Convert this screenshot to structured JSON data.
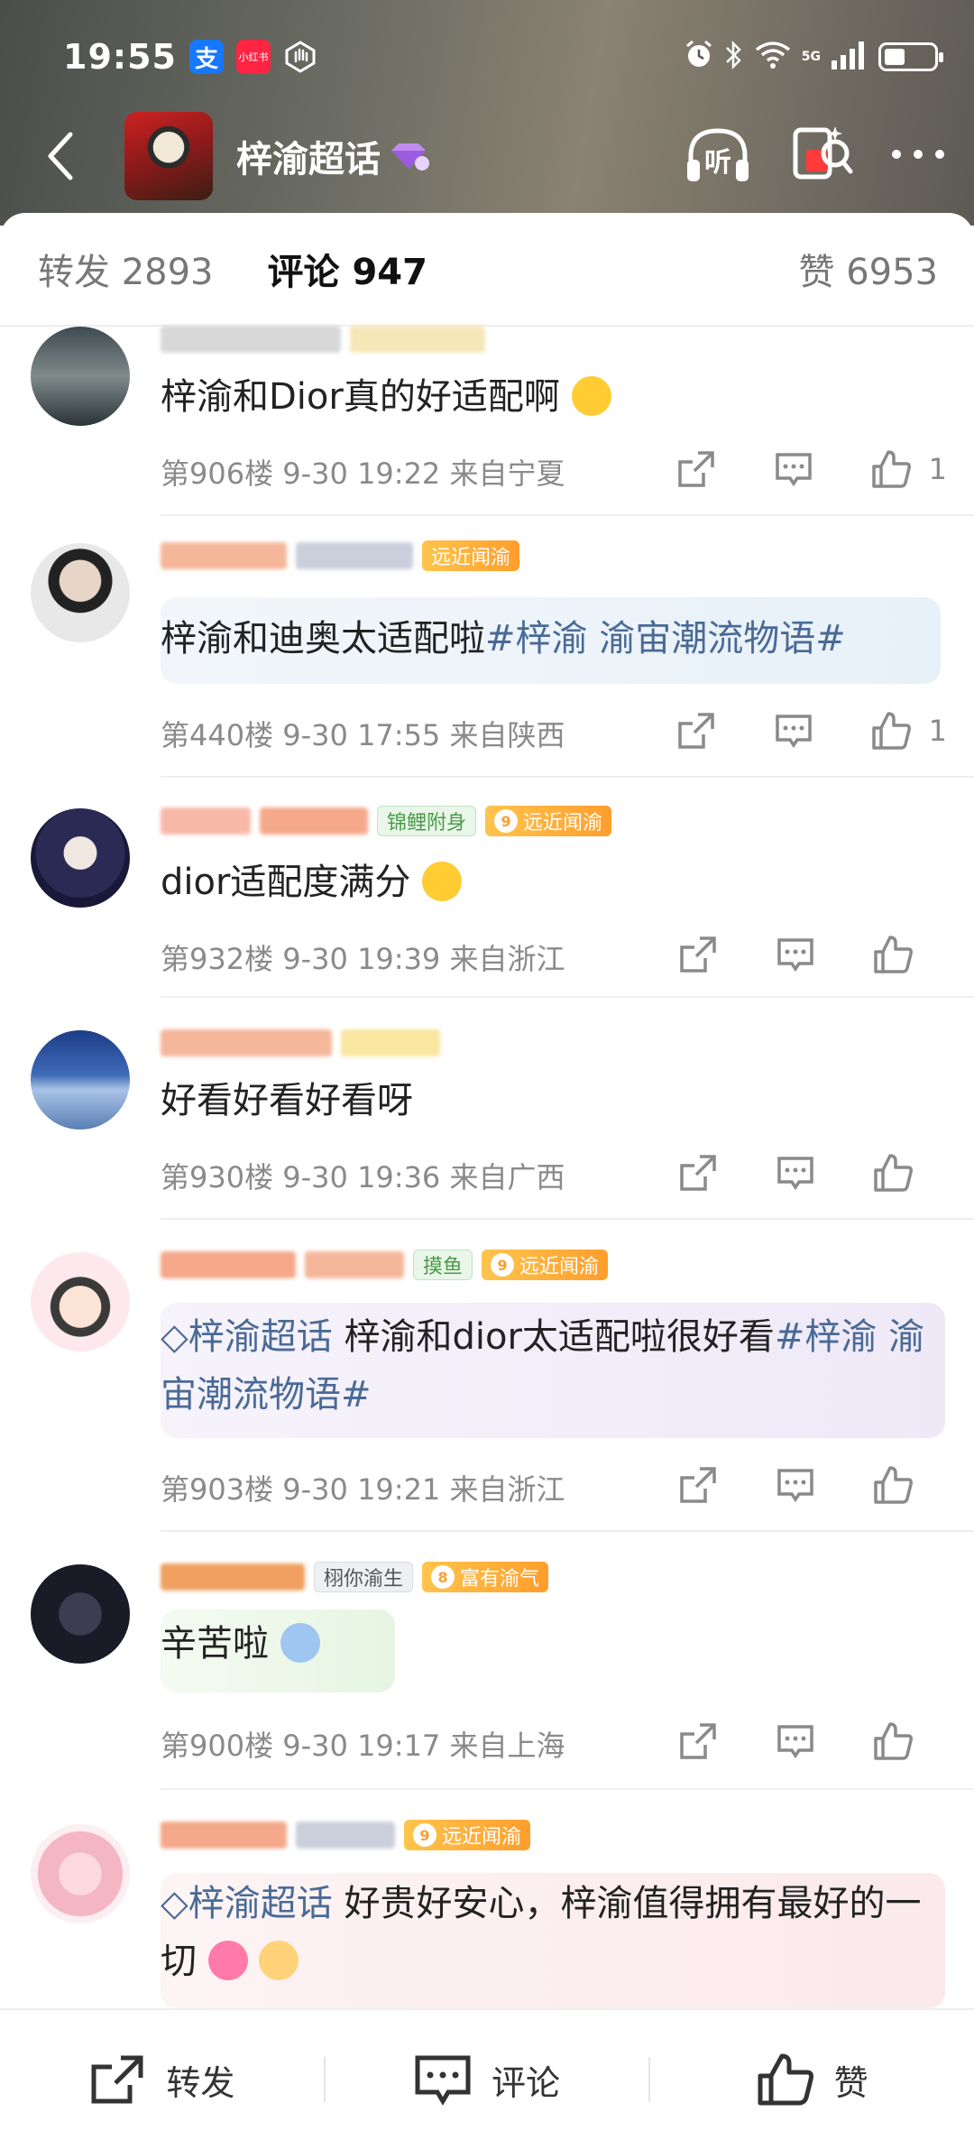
{
  "status_bar": {
    "time": "19:55",
    "alipay_label": "支",
    "xhs_label": "小红书",
    "network": "5G"
  },
  "header": {
    "title": "梓渝超话",
    "listen_label": "听"
  },
  "tabs": {
    "repost": "转发 2893",
    "comment": "评论 947",
    "like": "赞 6953"
  },
  "comments": [
    {
      "text": "梓渝和Dior真的好适配啊",
      "floor": "第906楼",
      "time": "9-30 19:22",
      "location": "来自宁夏",
      "likes": "1"
    },
    {
      "text_prefix": "梓渝和迪奥太适配啦",
      "topic": "#梓渝 渝宙潮流物语#",
      "badge": "远近闻渝",
      "floor": "第440楼",
      "time": "9-30 17:55",
      "location": "来自陕西",
      "likes": "1"
    },
    {
      "text": "dior适配度满分",
      "badge_fish": "锦鲤附身",
      "badge_lv": "9",
      "badge": "远近闻渝",
      "floor": "第932楼",
      "time": "9-30 19:39",
      "location": "来自浙江"
    },
    {
      "text": "好看好看好看呀",
      "floor": "第930楼",
      "time": "9-30 19:36",
      "location": "来自广西"
    },
    {
      "topic_prefix": "梓渝超话",
      "text_main": " 梓渝和dior太适配啦很好看",
      "topic": "#梓渝 渝宙潮流物语#",
      "badge_fish": "摸鱼",
      "badge_lv": "9",
      "badge": "远近闻渝",
      "floor": "第903楼",
      "time": "9-30 19:21",
      "location": "来自浙江"
    },
    {
      "text": "辛苦啦",
      "badge_fan": "栩你渝生",
      "badge_lv": "8",
      "badge": "富有渝气",
      "floor": "第900楼",
      "time": "9-30 19:17",
      "location": "来自上海"
    },
    {
      "topic_prefix": "梓渝超话",
      "text_main": " 好贵好安心，梓渝值得拥有最好的一切",
      "badge_lv": "9",
      "badge": "远近闻渝"
    }
  ],
  "bottom_bar": {
    "repost": "转发",
    "comment": "评论",
    "like": "赞"
  },
  "colors": {
    "topic": "#4a6a96",
    "badge_orange": "#ff9e2c"
  }
}
